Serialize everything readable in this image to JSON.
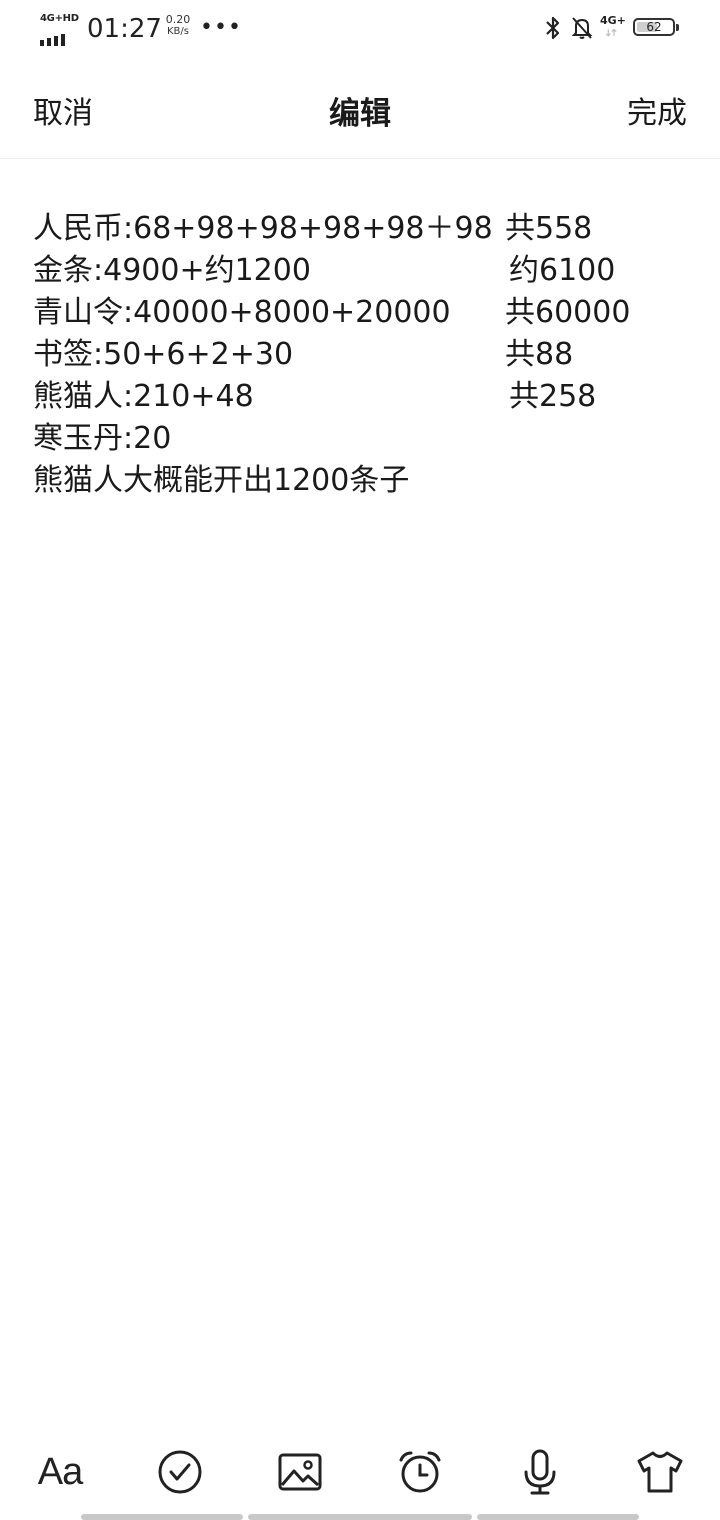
{
  "status_bar": {
    "network_label": "4G+HD",
    "time": "01:27",
    "speed_value": "0.20",
    "speed_unit": "KB/s",
    "more_dots": "•••",
    "mobile_data_label": "4G+",
    "battery_level": "62",
    "battery_fraction": 0.62,
    "icons": [
      "signal-icon",
      "bluetooth-icon",
      "bell-off-icon",
      "battery-icon"
    ]
  },
  "nav": {
    "cancel_label": "取消",
    "title": "编辑",
    "done_label": "完成"
  },
  "note": {
    "lines": [
      {
        "left": "人民币:68+98+98+98+98＋98",
        "right": "共558"
      },
      {
        "left": "金条:4900+约1200",
        "right": "约6100"
      },
      {
        "left": "青山令:40000+8000+20000",
        "right": "共60000"
      },
      {
        "left": "书签:50+6+2+30",
        "right": "共88"
      },
      {
        "left": "熊猫人:210+48",
        "right": "共258"
      },
      {
        "left": "寒玉丹:20",
        "right": ""
      },
      {
        "left": "熊猫人大概能开出1200条子",
        "right": ""
      }
    ]
  },
  "toolbar": {
    "text_format_label": "Aa",
    "icons": [
      "text-format-icon",
      "checklist-icon",
      "image-icon",
      "alarm-clock-icon",
      "microphone-icon",
      "shirt-theme-icon"
    ]
  }
}
